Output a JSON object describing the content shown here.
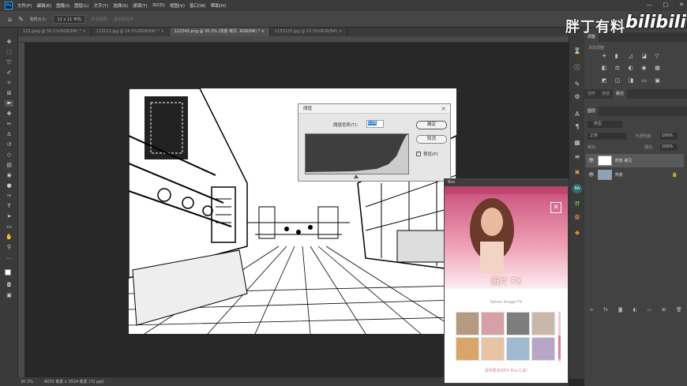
{
  "menu": {
    "items": [
      "文件(F)",
      "编辑(E)",
      "图像(I)",
      "图层(L)",
      "文字(Y)",
      "选择(S)",
      "滤镜(T)",
      "3D(D)",
      "视图(V)",
      "窗口(W)",
      "帮助(H)"
    ]
  },
  "window": {
    "minimize": "—",
    "maximize": "□",
    "close": "✕"
  },
  "options": {
    "sample_label": "取样大小:",
    "sample_value": "11 x 11 平均",
    "sample_layer": "所有图层",
    "show_ring": "显示取样环"
  },
  "tabs": [
    {
      "label": "123.jpeg @ 50.1%(RGB/8#) *",
      "close": "×"
    },
    {
      "label": "123123.jpg @ 24.3%(RGB/8#) *",
      "close": "×"
    },
    {
      "label": "122545.png @ 30.3% (背景 拷贝, RGB/8#) *",
      "close": "×"
    },
    {
      "label": "1153125.jpg @ 33.3%(RGB/8#)",
      "close": "×"
    }
  ],
  "status": {
    "zoom": "30.3%",
    "doc": "4032 像素 x 3024 像素 (72 ppi)"
  },
  "dialog": {
    "title": "阈值",
    "label": "阈值色阶(T):",
    "value": "128",
    "ok": "确定",
    "cancel": "取消",
    "preview": "预览(P)",
    "close": "×"
  },
  "fx": {
    "header": "Box",
    "title": "照片 FX",
    "subtitle": "Select Image FX",
    "footer": "获得更多的FX Box工具!",
    "close": "✕"
  },
  "panel": {
    "tabs_top": [
      "调整"
    ],
    "adjust_title": "添加调整",
    "tabs_mid": [
      "动作",
      "通道",
      "路径"
    ],
    "tabs_layers": [
      "图层"
    ],
    "kind": "类型",
    "normal": "正常",
    "opacity_label": "不透明度:",
    "opacity": "100%",
    "lock": "锁定:",
    "fill_label": "填充:",
    "fill": "100%",
    "layers": [
      {
        "name": "背景 拷贝"
      },
      {
        "name": "背景"
      }
    ]
  },
  "brand": {
    "text1": "胖丁有料",
    "text2": "bilibili"
  },
  "icons": {
    "eye": "eye-icon",
    "lock": "lock-icon"
  }
}
